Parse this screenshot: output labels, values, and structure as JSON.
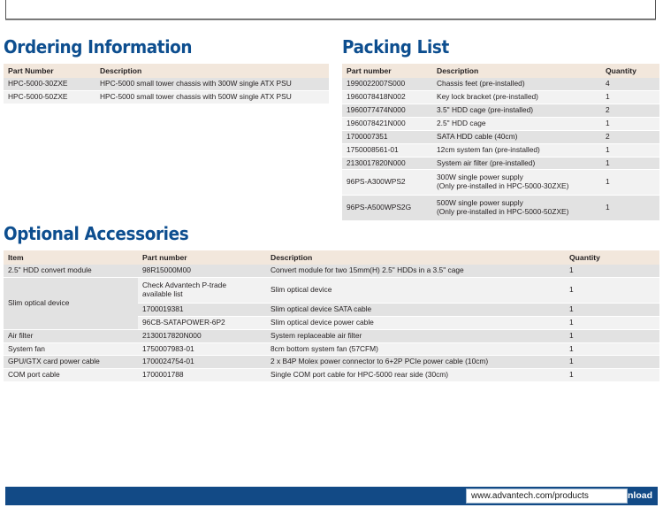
{
  "top_panel": {
    "ghost_text": "⌷"
  },
  "sections": {
    "ordering": {
      "title": "Ordering Information",
      "columns": [
        "Part Number",
        "Description"
      ],
      "rows": [
        [
          "HPC-5000-30ZXE",
          "HPC-5000 small tower chassis with 300W single ATX PSU"
        ],
        [
          "HPC-5000-50ZXE",
          "HPC-5000 small tower chassis with 500W single ATX PSU"
        ]
      ]
    },
    "packing": {
      "title": "Packing List",
      "columns": [
        "Part number",
        "Description",
        "Quantity"
      ],
      "rows": [
        {
          "part": "1990022007S000",
          "description": "Chassis feet (pre-installed)",
          "quantity": "4",
          "tall": false
        },
        {
          "part": "1960078418N002",
          "description": "Key lock bracket (pre-installed)",
          "quantity": "1",
          "tall": false
        },
        {
          "part": "1960077474N000",
          "description": "3.5\" HDD cage (pre-installed)",
          "quantity": "2",
          "tall": false
        },
        {
          "part": "1960078421N000",
          "description": "2.5\" HDD cage",
          "quantity": "1",
          "tall": false
        },
        {
          "part": "1700007351",
          "description": "SATA HDD cable (40cm)",
          "quantity": "2",
          "tall": false
        },
        {
          "part": "1750008561-01",
          "description": "12cm system fan (pre-installed)",
          "quantity": "1",
          "tall": false
        },
        {
          "part": "2130017820N000",
          "description": "System air filter (pre-installed)",
          "quantity": "1",
          "tall": false
        },
        {
          "part": "96PS-A300WPS2",
          "description": "300W single power supply\n(Only pre-installed in HPC-5000-30ZXE)",
          "quantity": "1",
          "tall": true
        },
        {
          "part": "96PS-A500WPS2G",
          "description": "500W single power supply\n(Only pre-installed in HPC-5000-50ZXE)",
          "quantity": "1",
          "tall": true
        }
      ]
    },
    "accessories": {
      "title": "Optional Accessories",
      "columns": [
        "Item",
        "Part number",
        "Description",
        "Quantity"
      ],
      "rows": [
        {
          "item": "2.5\" HDD convert module",
          "item_rowspan": 1,
          "part": "98R15000M00",
          "description": "Convert module for two 15mm(H) 2.5\" HDDs in a 3.5\" cage",
          "quantity": "1",
          "tall": false
        },
        {
          "item": "Slim optical device",
          "item_rowspan": 3,
          "part": "Check Advantech P-trade\navailable list",
          "description": "Slim optical device",
          "quantity": "1",
          "tall": true
        },
        {
          "item": null,
          "part": "1700019381",
          "description": "Slim optical device SATA cable",
          "quantity": "1",
          "tall": false
        },
        {
          "item": null,
          "part": "96CB-SATAPOWER-6P2",
          "description": "Slim optical device power cable",
          "quantity": "1",
          "tall": false
        },
        {
          "item": "Air filter",
          "item_rowspan": 1,
          "part": "2130017820N000",
          "description": "System replaceable air filter",
          "quantity": "1",
          "tall": false
        },
        {
          "item": "System fan",
          "item_rowspan": 1,
          "part": "1750007983-01",
          "description": "8cm bottom system fan (57CFM)",
          "quantity": "1",
          "tall": false
        },
        {
          "item": "GPU/GTX card power cable",
          "item_rowspan": 1,
          "part": "1700024754-01",
          "description": "2 x B4P Molex power connector to 6+2P PCIe power cable (10cm)",
          "quantity": "1",
          "tall": false
        },
        {
          "item": "COM port cable",
          "item_rowspan": 1,
          "part": "1700001788",
          "description": "Single COM port cable for HPC-5000 rear side (30cm)",
          "quantity": "1",
          "tall": false
        }
      ]
    }
  },
  "footer": {
    "label": "Online Download",
    "url": "www.advantech.com/products"
  },
  "colors": {
    "heading_blue": "#0d4e8f",
    "footer_blue": "#124a86",
    "table_header_cream": "#f2e7dc",
    "row_dark": "#e2e2e2",
    "row_light": "#f2f2f2"
  }
}
